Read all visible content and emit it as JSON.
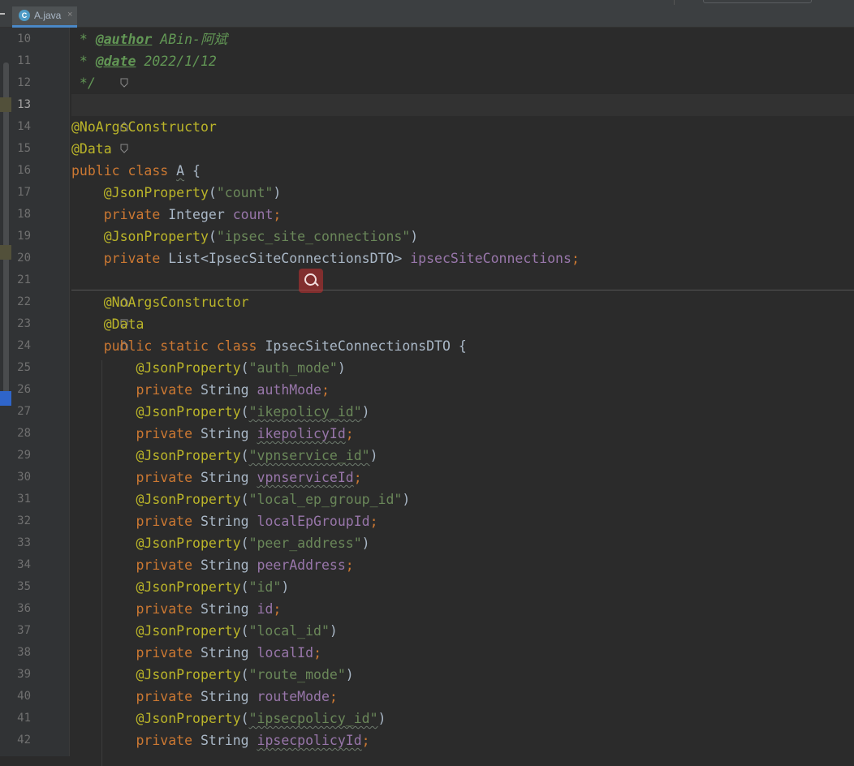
{
  "tab": {
    "label": "A.java",
    "file_icon_letter": "C",
    "close_glyph": "×"
  },
  "colors": {
    "background": "#2b2b2b",
    "keyword": "#cc7832",
    "annotation": "#bbb529",
    "string": "#6a8759",
    "field": "#9876aa",
    "identifier": "#a9b7c6",
    "doc_comment": "#629755"
  },
  "editor": {
    "current_line": 13,
    "lines": [
      {
        "n": "10",
        "t": [
          {
            "k": "doc",
            "v": " * "
          },
          {
            "k": "doctag",
            "v": "@author"
          },
          {
            "k": "docval",
            "v": " ABin-阿斌"
          }
        ]
      },
      {
        "n": "11",
        "t": [
          {
            "k": "doc",
            "v": " * "
          },
          {
            "k": "doctag",
            "v": "@date"
          },
          {
            "k": "docval",
            "v": " 2022/1/12"
          }
        ]
      },
      {
        "n": "12",
        "t": [
          {
            "k": "doc",
            "v": " */"
          }
        ]
      },
      {
        "n": "13",
        "t": []
      },
      {
        "n": "14",
        "t": [
          {
            "k": "ann",
            "v": "@NoArgsConstructor"
          }
        ]
      },
      {
        "n": "15",
        "t": [
          {
            "k": "ann",
            "v": "@Data"
          }
        ]
      },
      {
        "n": "16",
        "t": [
          {
            "k": "kw",
            "v": "public class "
          },
          {
            "k": "id",
            "v": "A",
            "w": true
          },
          {
            "k": "plain",
            "v": " {"
          }
        ]
      },
      {
        "n": "17",
        "t": [
          {
            "k": "plain",
            "v": "    "
          },
          {
            "k": "ann",
            "v": "@JsonProperty"
          },
          {
            "k": "plain",
            "v": "("
          },
          {
            "k": "str",
            "v": "\"count\""
          },
          {
            "k": "plain",
            "v": ")"
          }
        ]
      },
      {
        "n": "18",
        "t": [
          {
            "k": "plain",
            "v": "    "
          },
          {
            "k": "kw",
            "v": "private "
          },
          {
            "k": "plain",
            "v": "Integer "
          },
          {
            "k": "field",
            "v": "count"
          },
          {
            "k": "semi",
            "v": ";"
          }
        ]
      },
      {
        "n": "19",
        "t": [
          {
            "k": "plain",
            "v": "    "
          },
          {
            "k": "ann",
            "v": "@JsonProperty"
          },
          {
            "k": "plain",
            "v": "("
          },
          {
            "k": "str",
            "v": "\"ipsec_site_connections\""
          },
          {
            "k": "plain",
            "v": ")"
          }
        ]
      },
      {
        "n": "20",
        "t": [
          {
            "k": "plain",
            "v": "    "
          },
          {
            "k": "kw",
            "v": "private "
          },
          {
            "k": "plain",
            "v": "List<IpsecSiteConnectionsDTO> "
          },
          {
            "k": "field",
            "v": "ipsecSiteConnections"
          },
          {
            "k": "semi",
            "v": ";"
          }
        ]
      },
      {
        "n": "21",
        "t": []
      },
      {
        "n": "22",
        "t": [
          {
            "k": "plain",
            "v": "    "
          },
          {
            "k": "ann",
            "v": "@NoArgsConstructor"
          }
        ]
      },
      {
        "n": "23",
        "t": [
          {
            "k": "plain",
            "v": "    "
          },
          {
            "k": "ann",
            "v": "@Data"
          }
        ]
      },
      {
        "n": "24",
        "t": [
          {
            "k": "plain",
            "v": "    "
          },
          {
            "k": "kw",
            "v": "public static class "
          },
          {
            "k": "plain",
            "v": "IpsecSiteConnectionsDTO {"
          }
        ]
      },
      {
        "n": "25",
        "t": [
          {
            "k": "plain",
            "v": "        "
          },
          {
            "k": "ann",
            "v": "@JsonProperty"
          },
          {
            "k": "plain",
            "v": "("
          },
          {
            "k": "str",
            "v": "\"auth_mode\""
          },
          {
            "k": "plain",
            "v": ")"
          }
        ]
      },
      {
        "n": "26",
        "t": [
          {
            "k": "plain",
            "v": "        "
          },
          {
            "k": "kw",
            "v": "private "
          },
          {
            "k": "plain",
            "v": "String "
          },
          {
            "k": "field",
            "v": "authMode"
          },
          {
            "k": "semi",
            "v": ";"
          }
        ]
      },
      {
        "n": "27",
        "t": [
          {
            "k": "plain",
            "v": "        "
          },
          {
            "k": "ann",
            "v": "@JsonProperty"
          },
          {
            "k": "plain",
            "v": "("
          },
          {
            "k": "str",
            "v": "\"ikepolicy_id\"",
            "w": true
          },
          {
            "k": "plain",
            "v": ")"
          }
        ]
      },
      {
        "n": "28",
        "t": [
          {
            "k": "plain",
            "v": "        "
          },
          {
            "k": "kw",
            "v": "private "
          },
          {
            "k": "plain",
            "v": "String "
          },
          {
            "k": "field",
            "v": "ikepolicyId",
            "w": true
          },
          {
            "k": "semi",
            "v": ";"
          }
        ]
      },
      {
        "n": "29",
        "t": [
          {
            "k": "plain",
            "v": "        "
          },
          {
            "k": "ann",
            "v": "@JsonProperty"
          },
          {
            "k": "plain",
            "v": "("
          },
          {
            "k": "str",
            "v": "\"vpnservice_id\"",
            "w": true
          },
          {
            "k": "plain",
            "v": ")"
          }
        ]
      },
      {
        "n": "30",
        "t": [
          {
            "k": "plain",
            "v": "        "
          },
          {
            "k": "kw",
            "v": "private "
          },
          {
            "k": "plain",
            "v": "String "
          },
          {
            "k": "field",
            "v": "vpnserviceId",
            "w": true
          },
          {
            "k": "semi",
            "v": ";"
          }
        ]
      },
      {
        "n": "31",
        "t": [
          {
            "k": "plain",
            "v": "        "
          },
          {
            "k": "ann",
            "v": "@JsonProperty"
          },
          {
            "k": "plain",
            "v": "("
          },
          {
            "k": "str",
            "v": "\"local_ep_group_id\""
          },
          {
            "k": "plain",
            "v": ")"
          }
        ]
      },
      {
        "n": "32",
        "t": [
          {
            "k": "plain",
            "v": "        "
          },
          {
            "k": "kw",
            "v": "private "
          },
          {
            "k": "plain",
            "v": "String "
          },
          {
            "k": "field",
            "v": "localEpGroupId"
          },
          {
            "k": "semi",
            "v": ";"
          }
        ]
      },
      {
        "n": "33",
        "t": [
          {
            "k": "plain",
            "v": "        "
          },
          {
            "k": "ann",
            "v": "@JsonProperty"
          },
          {
            "k": "plain",
            "v": "("
          },
          {
            "k": "str",
            "v": "\"peer_address\""
          },
          {
            "k": "plain",
            "v": ")"
          }
        ]
      },
      {
        "n": "34",
        "t": [
          {
            "k": "plain",
            "v": "        "
          },
          {
            "k": "kw",
            "v": "private "
          },
          {
            "k": "plain",
            "v": "String "
          },
          {
            "k": "field",
            "v": "peerAddress"
          },
          {
            "k": "semi",
            "v": ";"
          }
        ]
      },
      {
        "n": "35",
        "t": [
          {
            "k": "plain",
            "v": "        "
          },
          {
            "k": "ann",
            "v": "@JsonProperty"
          },
          {
            "k": "plain",
            "v": "("
          },
          {
            "k": "str",
            "v": "\"id\""
          },
          {
            "k": "plain",
            "v": ")"
          }
        ]
      },
      {
        "n": "36",
        "t": [
          {
            "k": "plain",
            "v": "        "
          },
          {
            "k": "kw",
            "v": "private "
          },
          {
            "k": "plain",
            "v": "String "
          },
          {
            "k": "field",
            "v": "id"
          },
          {
            "k": "semi",
            "v": ";"
          }
        ]
      },
      {
        "n": "37",
        "t": [
          {
            "k": "plain",
            "v": "        "
          },
          {
            "k": "ann",
            "v": "@JsonProperty"
          },
          {
            "k": "plain",
            "v": "("
          },
          {
            "k": "str",
            "v": "\"local_id\""
          },
          {
            "k": "plain",
            "v": ")"
          }
        ]
      },
      {
        "n": "38",
        "t": [
          {
            "k": "plain",
            "v": "        "
          },
          {
            "k": "kw",
            "v": "private "
          },
          {
            "k": "plain",
            "v": "String "
          },
          {
            "k": "field",
            "v": "localId"
          },
          {
            "k": "semi",
            "v": ";"
          }
        ]
      },
      {
        "n": "39",
        "t": [
          {
            "k": "plain",
            "v": "        "
          },
          {
            "k": "ann",
            "v": "@JsonProperty"
          },
          {
            "k": "plain",
            "v": "("
          },
          {
            "k": "str",
            "v": "\"route_mode\""
          },
          {
            "k": "plain",
            "v": ")"
          }
        ]
      },
      {
        "n": "40",
        "t": [
          {
            "k": "plain",
            "v": "        "
          },
          {
            "k": "kw",
            "v": "private "
          },
          {
            "k": "plain",
            "v": "String "
          },
          {
            "k": "field",
            "v": "routeMode"
          },
          {
            "k": "semi",
            "v": ";"
          }
        ]
      },
      {
        "n": "41",
        "t": [
          {
            "k": "plain",
            "v": "        "
          },
          {
            "k": "ann",
            "v": "@JsonProperty"
          },
          {
            "k": "plain",
            "v": "("
          },
          {
            "k": "str",
            "v": "\"ipsecpolicy_id\"",
            "w": true
          },
          {
            "k": "plain",
            "v": ")"
          }
        ]
      },
      {
        "n": "42",
        "t": [
          {
            "k": "plain",
            "v": "        "
          },
          {
            "k": "kw",
            "v": "private "
          },
          {
            "k": "plain",
            "v": "String "
          },
          {
            "k": "field",
            "v": "ipsecpolicyId",
            "w": true
          },
          {
            "k": "semi",
            "v": ";"
          }
        ]
      }
    ]
  }
}
